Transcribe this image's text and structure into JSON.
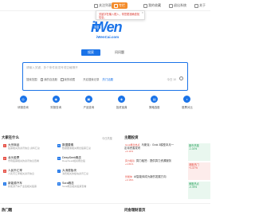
{
  "topbar": {
    "items": [
      {
        "label": "关注列表",
        "active": false
      },
      {
        "label": "专栏",
        "active": true
      },
      {
        "label": "我的收藏",
        "active": false
      },
      {
        "label": "退出系统",
        "active": false
      },
      {
        "label": "关于",
        "active": false
      }
    ]
  },
  "tooltip": {
    "text": "关键字在输入框入，帮您更准确查找信息。",
    "close": "×"
  },
  "logo": {
    "title": "iWen",
    "badge": "问金",
    "domain": "iWenCai.com"
  },
  "modes": {
    "primary": "搜索",
    "secondary": "问问题"
  },
  "search": {
    "placeholder": "请输入关键，多个条件用逗号或空格隔开",
    "opt1": "搜索范围",
    "opt2": "我的自选股",
    "opt3": "我的收藏",
    "opt4": "开启搜索记录",
    "hot_label": "热门话题",
    "count": "今日 10",
    "accent": "#1a73e8"
  },
  "icons": [
    {
      "label": "研报查询",
      "glyph": "◎"
    },
    {
      "label": "财报查询",
      "glyph": "◉"
    },
    {
      "label": "产品查询",
      "glyph": "▣"
    },
    {
      "label": "投资宝典",
      "glyph": "◈"
    },
    {
      "label": "策略选股",
      "glyph": "▤"
    },
    {
      "label": "股票对比",
      "glyph": "◐"
    }
  ],
  "left_panel": {
    "title": "大家在什么",
    "more": "今日热搜",
    "rows": [
      {
        "num": "1",
        "title": "大宗商品",
        "desc": "股票相关的资讯信息 资料汇总"
      },
      {
        "num": "2",
        "title": "龙头股票",
        "desc": "市场股票相关的资讯信息查看"
      },
      {
        "num": "3",
        "title": "人民币汇率",
        "desc": "人民币汇率相关资讯信息"
      },
      {
        "num": "4",
        "title": "新能源汽车",
        "desc": "新能源汽车产业链相关股票"
      }
    ],
    "rows2": [
      {
        "num": "5",
        "title": "数据要素",
        "desc": "数据要素相关概念股票汇总"
      },
      {
        "num": "6",
        "title": "DeepSeek概念",
        "desc": "DeepSeek相关概念股"
      },
      {
        "num": "7",
        "title": "大消费板块",
        "desc": "消费相关的板块资讯汇总"
      },
      {
        "num": "8",
        "title": "Sora概念",
        "desc": "Sora概念相关股票查看"
      }
    ]
  },
  "hot_panel": {
    "title": "主题投资",
    "cards": [
      {
        "title": "Grok概念热点",
        "text": "马斯克：Grok 3模型本月一定将完善发布",
        "value": "+4.11%",
        "color": "red"
      },
      {
        "title": "算力租赁",
        "text": "算力租赁：提供算力资源服务",
        "value": "+1.81%",
        "color": "red"
      },
      {
        "title": "智能体",
        "text": "AI智能体成为新的发展方向",
        "value": "+3.16%",
        "color": "red"
      }
    ],
    "side": [
      {
        "label": "股市热搜",
        "value": "-1.01%",
        "color": "green"
      },
      {
        "label": "港股热门",
        "value": "+1.57%",
        "color": "red"
      },
      {
        "label": "美股热点",
        "value": "-0.78%",
        "color": "green"
      }
    ]
  },
  "bottom": {
    "left_title": "热门题",
    "right_title": "问金理财首页"
  }
}
